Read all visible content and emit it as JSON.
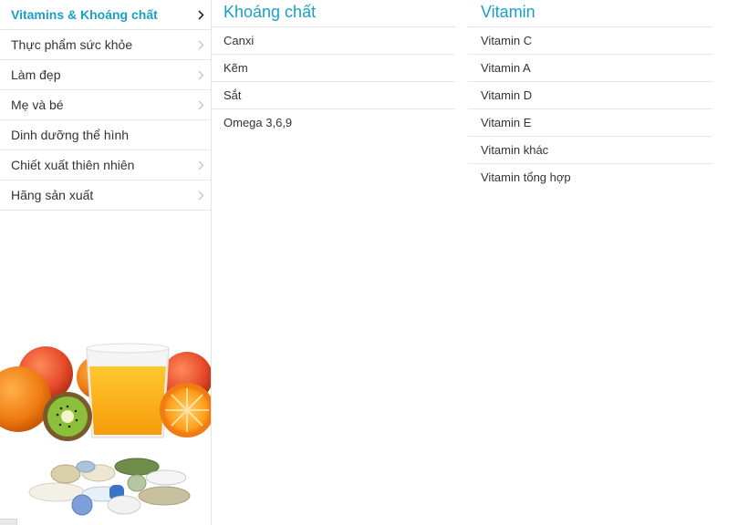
{
  "sidebar": {
    "items": [
      {
        "label": "Vitamins & Khoáng chất",
        "active": true,
        "chevron": true
      },
      {
        "label": "Thực phẩm sức khỏe",
        "active": false,
        "chevron": true
      },
      {
        "label": "Làm đẹp",
        "active": false,
        "chevron": true
      },
      {
        "label": "Mẹ và bé",
        "active": false,
        "chevron": true
      },
      {
        "label": "Dinh dưỡng thể hình",
        "active": false,
        "chevron": false
      },
      {
        "label": "Chiết xuất thiên nhiên",
        "active": false,
        "chevron": true
      },
      {
        "label": "Hãng sản xuất",
        "active": false,
        "chevron": true
      }
    ],
    "promo_image": "fruits-juice-and-pills-illustration"
  },
  "columns": [
    {
      "title": "Khoáng chất",
      "items": [
        "Canxi",
        "Kẽm",
        "Sắt",
        "Omega 3,6,9"
      ]
    },
    {
      "title": "Vitamin",
      "items": [
        "Vitamin C",
        "Vitamin A",
        "Vitamin D",
        "Vitamin E",
        "Vitamin khác",
        "Vitamin tổng hợp"
      ]
    }
  ],
  "colors": {
    "accent": "#1a9fc6",
    "text": "#333333",
    "divider": "#e6e6e6"
  }
}
